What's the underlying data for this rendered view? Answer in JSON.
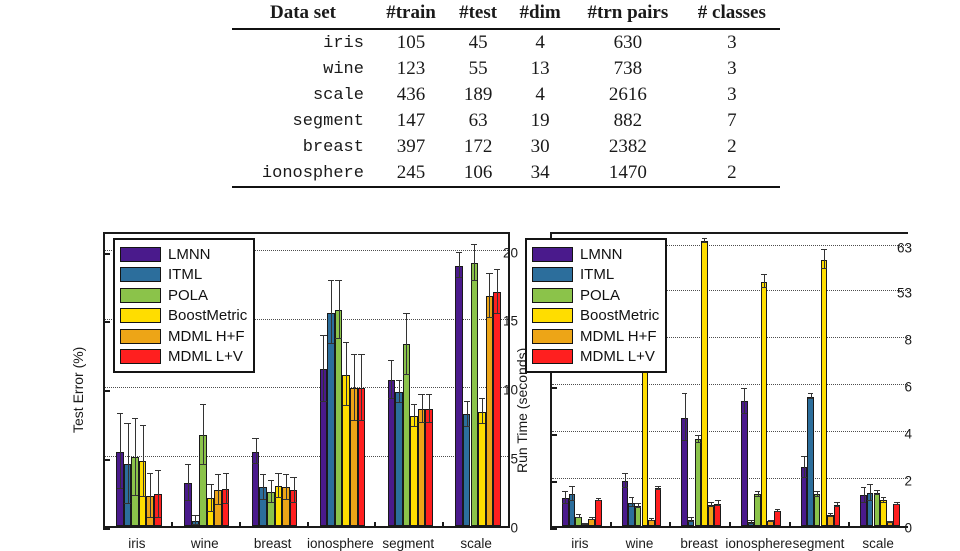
{
  "table": {
    "headers": [
      "Data set",
      "#train",
      "#test",
      "#dim",
      "#trn pairs",
      "# classes"
    ],
    "rows": [
      {
        "name": "iris",
        "train": "105",
        "test": "45",
        "dim": "4",
        "pairs": "630",
        "classes": "3"
      },
      {
        "name": "wine",
        "train": "123",
        "test": "55",
        "dim": "13",
        "pairs": "738",
        "classes": "3"
      },
      {
        "name": "scale",
        "train": "436",
        "test": "189",
        "dim": "4",
        "pairs": "2616",
        "classes": "3"
      },
      {
        "name": "segment",
        "train": "147",
        "test": "63",
        "dim": "19",
        "pairs": "882",
        "classes": "7"
      },
      {
        "name": "breast",
        "train": "397",
        "test": "172",
        "dim": "30",
        "pairs": "2382",
        "classes": "2"
      },
      {
        "name": "ionosphere",
        "train": "245",
        "test": "106",
        "dim": "34",
        "pairs": "1470",
        "classes": "2"
      }
    ]
  },
  "series_colors": {
    "LMNN": "#4a1a8c",
    "ITML": "#2c6e9c",
    "POLA": "#8bc34a",
    "BoostMetric": "#ffdd00",
    "MDML H+F": "#eda517",
    "MDML L+V": "#ff1f1f"
  },
  "legend": {
    "entries": [
      {
        "label": "LMNN",
        "color": "#4a1a8c"
      },
      {
        "label": "ITML",
        "color": "#2c6e9c"
      },
      {
        "label": "POLA",
        "color": "#8bc34a"
      },
      {
        "label": "BoostMetric",
        "color": "#ffdd00"
      },
      {
        "label": "MDML H+F",
        "color": "#eda517"
      },
      {
        "label": "MDML L+V",
        "color": "#ff1f1f"
      }
    ]
  },
  "chart_data": [
    {
      "id": "test-error",
      "type": "bar",
      "title": "",
      "xlabel": "",
      "ylabel": "Test Error (%)",
      "ylim": [
        0,
        21.5
      ],
      "yticks": [
        0,
        5,
        10,
        15,
        20
      ],
      "grid": true,
      "legend_position": "top-left",
      "categories": [
        "iris",
        "wine",
        "breast",
        "ionosphere",
        "segment",
        "scale"
      ],
      "series": [
        {
          "name": "LMNN",
          "values": [
            5.4,
            3.1,
            5.4,
            11.4,
            10.6,
            18.9
          ],
          "errors": [
            2.7,
            1.3,
            0.9,
            2.4,
            1.4,
            0.9
          ]
        },
        {
          "name": "ITML",
          "values": [
            4.5,
            0.4,
            2.8,
            15.5,
            9.7,
            8.1
          ],
          "errors": [
            2.9,
            0.3,
            0.9,
            2.3,
            0.8,
            0.9
          ]
        },
        {
          "name": "POLA",
          "values": [
            5.0,
            6.6,
            2.5,
            15.7,
            13.2,
            19.1
          ],
          "errors": [
            2.8,
            2.2,
            0.8,
            2.1,
            2.2,
            1.3
          ]
        },
        {
          "name": "BoostMetric",
          "values": [
            4.7,
            2.0,
            2.9,
            11.0,
            8.0,
            8.3
          ],
          "errors": [
            2.6,
            1.0,
            0.9,
            2.3,
            0.8,
            0.9
          ]
        },
        {
          "name": "MDML H+F",
          "values": [
            2.2,
            2.6,
            2.8,
            10.0,
            8.5,
            16.7
          ],
          "errors": [
            1.6,
            1.1,
            0.9,
            2.4,
            1.0,
            1.6
          ]
        },
        {
          "name": "MDML L+V",
          "values": [
            2.3,
            2.7,
            2.6,
            10.0,
            8.5,
            17.0
          ],
          "errors": [
            1.7,
            1.1,
            0.9,
            2.4,
            1.0,
            1.6
          ]
        }
      ]
    },
    {
      "id": "run-time",
      "type": "bar",
      "title": "",
      "xlabel": "",
      "ylabel": "Run Time (seconds)",
      "ylim": [
        0,
        68
      ],
      "yticks": [
        0,
        2,
        4,
        6,
        8,
        53,
        63
      ],
      "broken_axis": true,
      "grid": true,
      "legend_position": "top-left",
      "categories": [
        "iris",
        "wine",
        "breast",
        "ionosphere",
        "segment",
        "scale"
      ],
      "series": [
        {
          "name": "LMNN",
          "values": [
            1.2,
            1.9,
            4.6,
            5.3,
            2.5,
            1.3
          ],
          "errors": [
            0.25,
            0.3,
            1.0,
            0.55,
            0.45,
            0.3
          ]
        },
        {
          "name": "ITML",
          "values": [
            1.35,
            1.0,
            0.25,
            0.15,
            5.5,
            1.4
          ],
          "errors": [
            0.3,
            0.2,
            0.1,
            0.05,
            0.1,
            0.35
          ]
        },
        {
          "name": "POLA",
          "values": [
            0.4,
            0.85,
            3.7,
            1.35,
            1.35,
            1.4
          ],
          "errors": [
            0.05,
            0.1,
            0.15,
            0.1,
            0.1,
            0.1
          ]
        },
        {
          "name": "BoostMetric",
          "values": [
            0.07,
            6.9,
            66.0,
            55.0,
            60.0,
            1.1
          ],
          "errors": [
            0.02,
            0.25,
            1.0,
            1.5,
            2.2,
            0.1
          ]
        },
        {
          "name": "MDML H+F",
          "values": [
            0.3,
            0.25,
            0.9,
            0.2,
            0.45,
            0.15
          ],
          "errors": [
            0.05,
            0.05,
            0.1,
            0.03,
            0.05,
            0.03
          ]
        },
        {
          "name": "MDML L+V",
          "values": [
            1.1,
            1.6,
            0.95,
            0.65,
            0.9,
            0.95
          ],
          "errors": [
            0.05,
            0.05,
            0.1,
            0.05,
            0.1,
            0.05
          ]
        }
      ]
    }
  ]
}
